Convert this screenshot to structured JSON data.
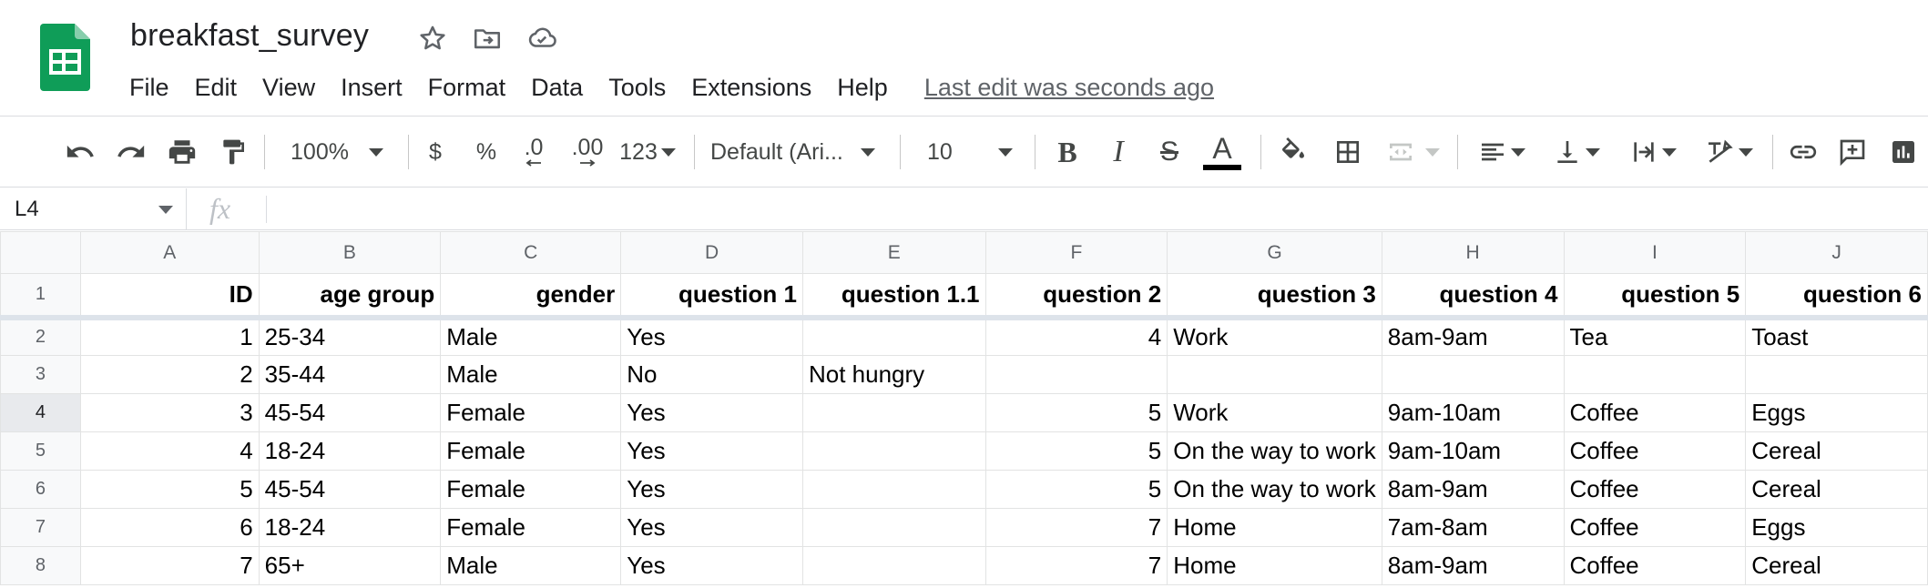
{
  "app": {
    "title": "breakfast_survey",
    "menu": [
      "File",
      "Edit",
      "View",
      "Insert",
      "Format",
      "Data",
      "Tools",
      "Extensions",
      "Help"
    ],
    "last_edit": "Last edit was seconds ago"
  },
  "toolbar": {
    "zoom": "100%",
    "currency": "$",
    "percent": "%",
    "decrease_decimal": ".0",
    "increase_decimal": ".00",
    "more_formats": "123",
    "font": "Default (Ari...",
    "font_size": "10",
    "bold": "B",
    "italic": "I",
    "strike": "S",
    "text_color": "A",
    "text_color_value": "#000000"
  },
  "formula_bar": {
    "name_box": "L4",
    "fx": "fx",
    "value": ""
  },
  "sheet": {
    "column_headers": [
      "A",
      "B",
      "C",
      "D",
      "E",
      "F",
      "G",
      "H",
      "I",
      "J"
    ],
    "active_row": 4,
    "header_row": [
      "ID",
      "age group",
      "gender",
      "question 1",
      "question 1.1",
      "question 2",
      "question 3",
      "question 4",
      "question 5",
      "question 6"
    ],
    "rows": [
      {
        "num": "2",
        "cells": [
          "1",
          "25-34",
          "Male",
          "Yes",
          "",
          "4",
          "Work",
          "8am-9am",
          "Tea",
          "Toast"
        ]
      },
      {
        "num": "3",
        "cells": [
          "2",
          "35-44",
          "Male",
          "No",
          "Not hungry",
          "",
          "",
          "",
          "",
          ""
        ]
      },
      {
        "num": "4",
        "cells": [
          "3",
          "45-54",
          "Female",
          "Yes",
          "",
          "5",
          "Work",
          "9am-10am",
          "Coffee",
          "Eggs"
        ]
      },
      {
        "num": "5",
        "cells": [
          "4",
          "18-24",
          "Female",
          "Yes",
          "",
          "5",
          "On the way to work",
          "9am-10am",
          "Coffee",
          "Cereal"
        ]
      },
      {
        "num": "6",
        "cells": [
          "5",
          "45-54",
          "Female",
          "Yes",
          "",
          "5",
          "On the way to work",
          "8am-9am",
          "Coffee",
          "Cereal"
        ]
      },
      {
        "num": "7",
        "cells": [
          "6",
          "18-24",
          "Female",
          "Yes",
          "",
          "7",
          "Home",
          "7am-8am",
          "Coffee",
          "Eggs"
        ]
      },
      {
        "num": "8",
        "cells": [
          "7",
          "65+",
          "Male",
          "Yes",
          "",
          "7",
          "Home",
          "8am-9am",
          "Coffee",
          "Cereal"
        ]
      }
    ]
  },
  "colors": {
    "brand_green": "#0f9d58",
    "header_bg": "#f8f9fa",
    "grid_line": "#e2e3e3"
  }
}
